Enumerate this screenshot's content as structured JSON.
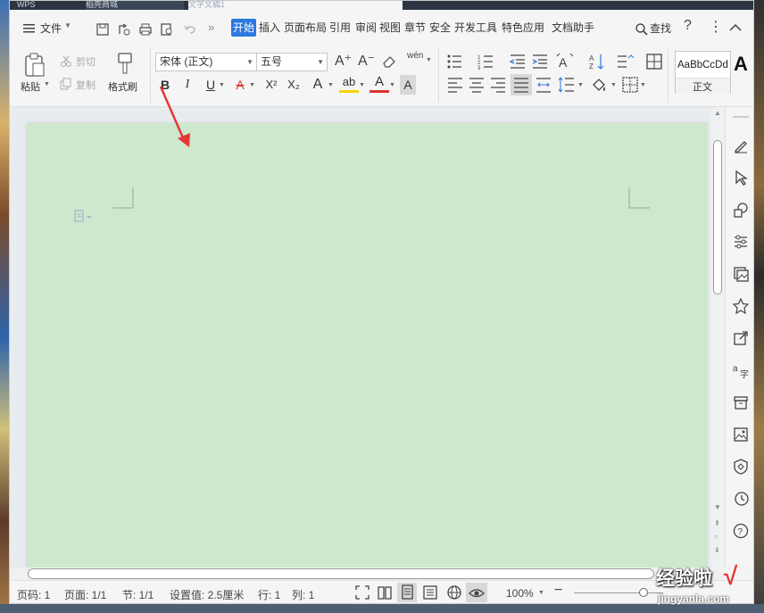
{
  "tabs": {
    "t1": "WPS",
    "t2": "稻壳商城",
    "t3": "文字文稿1"
  },
  "menu": {
    "file_label": "文件",
    "items": [
      "开始",
      "插入",
      "页面布局",
      "引用",
      "审阅",
      "视图",
      "章节",
      "安全",
      "开发工具",
      "特色应用",
      "文档助手"
    ],
    "active_item": "开始",
    "search_label": "查找",
    "help_label": "?"
  },
  "ribbon": {
    "paste_label": "粘贴",
    "cut_label": "剪切",
    "copy_label": "复制",
    "format_painter_label": "格式刷",
    "font_name": "宋体 (正文)",
    "font_size": "五号",
    "bold": "B",
    "italic": "I",
    "underline": "U",
    "strike": "A",
    "superscript": "X²",
    "subscript": "X₂",
    "text_effect": "A",
    "highlight": "ab",
    "font_color": "A",
    "char_shading": "A",
    "phonetic": "wén",
    "grow_font": "A⁺",
    "shrink_font": "A⁻",
    "style_sample": "AaBbCcDd",
    "style_name": "正文",
    "style_next": "A"
  },
  "status": {
    "page_code": "页码: 1",
    "pages": "页面: 1/1",
    "section": "节: 1/1",
    "setting_value": "设置值: 2.5厘米",
    "row": "行: 1",
    "col": "列: 1",
    "zoom": "100%",
    "zoom_level": 0.5
  },
  "watermark": {
    "title": "经验啦",
    "check": "√",
    "url": "jingyanla.com"
  },
  "colors": {
    "accent": "#2b79e0",
    "page_bg": "#cde8cd",
    "arrow": "#e53935",
    "font_color_bar": "#d9342b",
    "highlight_bar": "#f6d400"
  },
  "icons": [
    "menu-icon",
    "save-icon",
    "print-icon",
    "search-icon",
    "paste-icon",
    "scissors-icon",
    "copy-icon",
    "brush-icon",
    "eraser-icon",
    "bullet-list-icon",
    "numbered-list-icon",
    "indent-icon",
    "outdent-icon",
    "align-left-icon",
    "align-center-icon",
    "align-right-icon",
    "justify-icon",
    "line-spacing-icon",
    "shading-icon",
    "border-icon",
    "pen-icon",
    "cursor-icon",
    "shapes-icon",
    "adjust-icon",
    "gallery-icon",
    "star-icon",
    "share-icon",
    "translate-icon",
    "archive-icon",
    "image-icon",
    "shield-icon",
    "history-icon",
    "help-icon",
    "fullscreen-icon",
    "read-mode-icon",
    "page-view-icon",
    "outline-icon",
    "web-view-icon",
    "eye-icon"
  ]
}
